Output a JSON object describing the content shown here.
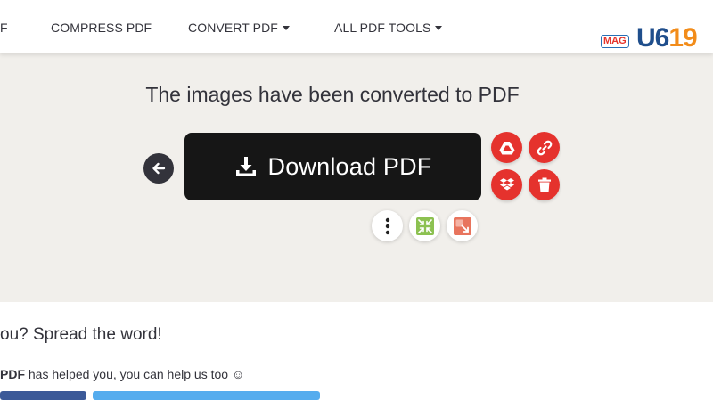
{
  "nav": {
    "partial_item": "F",
    "items": [
      {
        "label": "COMPRESS PDF",
        "has_caret": false
      },
      {
        "label": "CONVERT PDF",
        "has_caret": true
      },
      {
        "label": "ALL PDF TOOLS",
        "has_caret": true
      }
    ]
  },
  "logo": {
    "badge": "MAG",
    "mark_part1": "U",
    "mark_part2": "6",
    "mark_part3": "19"
  },
  "hero": {
    "title": "The images have been converted to PDF",
    "download_label": "Download PDF",
    "icons": {
      "back": "arrow-left-icon",
      "download": "download-icon",
      "drive": "google-drive-icon",
      "link": "link-icon",
      "dropbox": "dropbox-icon",
      "delete": "trash-icon",
      "more": "more-vertical-icon",
      "compress": "compress-icon",
      "split": "split-icon"
    }
  },
  "spread": {
    "title": "ou? Spread the word!",
    "text_bold": "PDF",
    "text_rest": " has helped you, you can help us too ☺"
  },
  "colors": {
    "accent_red": "#e5322d",
    "hero_bg": "#f1efeb",
    "download_bg": "#161616",
    "text_dark": "#33333b",
    "facebook": "#3b5998",
    "twitter": "#55acee"
  }
}
